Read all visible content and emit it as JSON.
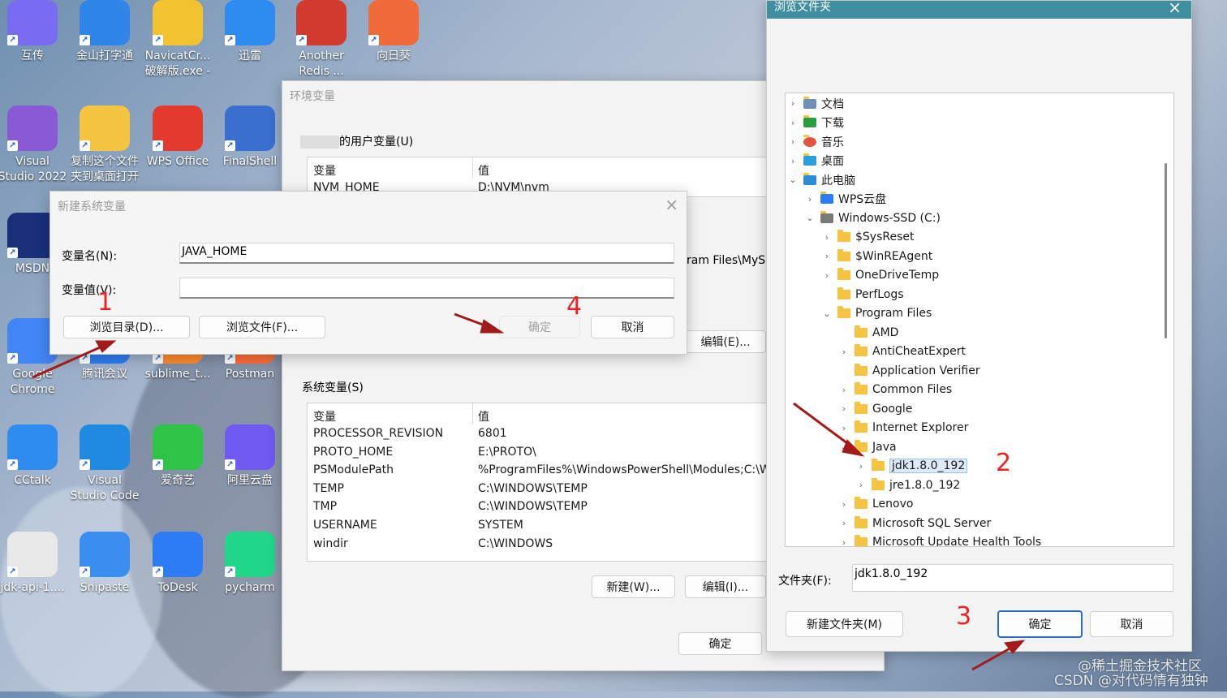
{
  "desktop_icons": [
    {
      "label": "互传",
      "color": "#7a6cf2"
    },
    {
      "label": "金山打字通",
      "color": "#2f86e8"
    },
    {
      "label": "NavicatCr... 破解版.exe -",
      "color": "#f2c230"
    },
    {
      "label": "迅雷",
      "color": "#2e8cf0"
    },
    {
      "label": "Another Redis ...",
      "color": "#d23a2f"
    },
    {
      "label": "向日葵",
      "color": "#f06a3a"
    },
    {
      "label": "Visual Studio 2022",
      "color": "#8a5ad6"
    },
    {
      "label": "复制这个文件夹到桌面打开",
      "color": "#f5c542"
    },
    {
      "label": "WPS Office",
      "color": "#e43a2e"
    },
    {
      "label": "FinalShell",
      "color": "#3a6fd0"
    },
    {
      "label": "MSDN",
      "color": "#1a2f7a"
    },
    {
      "label": "Google Chrome",
      "color": "#4285f4"
    },
    {
      "label": "腾讯会议",
      "color": "#2e7cf5"
    },
    {
      "label": "sublime_t...",
      "color": "#ff8a2e"
    },
    {
      "label": "Postman",
      "color": "#ff6c37"
    },
    {
      "label": "CCtalk",
      "color": "#2e8cf0"
    },
    {
      "label": "Visual Studio Code",
      "color": "#1f8ae0"
    },
    {
      "label": "爱奇艺",
      "color": "#2ec448"
    },
    {
      "label": "阿里云盘",
      "color": "#6f5af2"
    },
    {
      "label": "jdk-api-1....",
      "color": "#e8e8e8"
    },
    {
      "label": "Snipaste",
      "color": "#3a8ef0"
    },
    {
      "label": "ToDesk",
      "color": "#2e7cf5"
    },
    {
      "label": "pycharm",
      "color": "#21d789"
    }
  ],
  "env_window": {
    "title": "环境变量",
    "user_vars_label": "的用户变量(U)",
    "user_header": [
      "变量",
      "值"
    ],
    "user_rows": [
      [
        "NVM_HOME",
        "D:\\NVM\\nvm"
      ]
    ],
    "path_fragment": "ram Files\\MyS",
    "edit_user_btn": "编辑(E)...",
    "sys_vars_label": "系统变量(S)",
    "sys_header": [
      "变量",
      "值"
    ],
    "sys_rows": [
      [
        "PROCESSOR_REVISION",
        "6801"
      ],
      [
        "PROTO_HOME",
        "E:\\PROTO\\"
      ],
      [
        "PSModulePath",
        "%ProgramFiles%\\WindowsPowerShell\\Modules;C:\\W"
      ],
      [
        "TEMP",
        "C:\\WINDOWS\\TEMP"
      ],
      [
        "TMP",
        "C:\\WINDOWS\\TEMP"
      ],
      [
        "USERNAME",
        "SYSTEM"
      ],
      [
        "windir",
        "C:\\WINDOWS"
      ]
    ],
    "new_btn": "新建(W)...",
    "edit_btn": "编辑(I)...",
    "ok_btn": "确定"
  },
  "new_var_dialog": {
    "title": "新建系统变量",
    "name_label": "变量名(N):",
    "name_value": "JAVA_HOME",
    "value_label": "变量值(V):",
    "value_value": "",
    "browse_dir_btn": "浏览目录(D)...",
    "browse_file_btn": "浏览文件(F)...",
    "ok_btn": "确定",
    "cancel_btn": "取消"
  },
  "folder_dialog": {
    "title": "浏览文件夹",
    "tree": [
      {
        "label": "文档",
        "indent": 0,
        "chev": "›",
        "icon": "doc"
      },
      {
        "label": "下载",
        "indent": 0,
        "chev": "›",
        "icon": "download"
      },
      {
        "label": "音乐",
        "indent": 0,
        "chev": "›",
        "icon": "music"
      },
      {
        "label": "桌面",
        "indent": 0,
        "chev": "›",
        "icon": "desktop"
      },
      {
        "label": "此电脑",
        "indent": 0,
        "chev": "⌄",
        "icon": "pc"
      },
      {
        "label": "WPS云盘",
        "indent": 1,
        "chev": "›",
        "icon": "cloud"
      },
      {
        "label": "Windows-SSD (C:)",
        "indent": 1,
        "chev": "⌄",
        "icon": "drive"
      },
      {
        "label": "$SysReset",
        "indent": 2,
        "chev": "›",
        "icon": "folder"
      },
      {
        "label": "$WinREAgent",
        "indent": 2,
        "chev": "›",
        "icon": "folder"
      },
      {
        "label": "OneDriveTemp",
        "indent": 2,
        "chev": "›",
        "icon": "folder"
      },
      {
        "label": "PerfLogs",
        "indent": 2,
        "chev": "",
        "icon": "folder"
      },
      {
        "label": "Program Files",
        "indent": 2,
        "chev": "⌄",
        "icon": "folder"
      },
      {
        "label": "AMD",
        "indent": 3,
        "chev": "",
        "icon": "folder"
      },
      {
        "label": "AntiCheatExpert",
        "indent": 3,
        "chev": "›",
        "icon": "folder"
      },
      {
        "label": "Application Verifier",
        "indent": 3,
        "chev": "",
        "icon": "folder"
      },
      {
        "label": "Common Files",
        "indent": 3,
        "chev": "›",
        "icon": "folder"
      },
      {
        "label": "Google",
        "indent": 3,
        "chev": "›",
        "icon": "folder"
      },
      {
        "label": "Internet Explorer",
        "indent": 3,
        "chev": "›",
        "icon": "folder"
      },
      {
        "label": "Java",
        "indent": 3,
        "chev": "⌄",
        "icon": "folder"
      },
      {
        "label": "jdk1.8.0_192",
        "indent": 4,
        "chev": "›",
        "icon": "folder",
        "selected": true
      },
      {
        "label": "jre1.8.0_192",
        "indent": 4,
        "chev": "›",
        "icon": "folder"
      },
      {
        "label": "Lenovo",
        "indent": 3,
        "chev": "›",
        "icon": "folder"
      },
      {
        "label": "Microsoft SQL Server",
        "indent": 3,
        "chev": "›",
        "icon": "folder"
      },
      {
        "label": "Microsoft Update Health Tools",
        "indent": 3,
        "chev": "›",
        "icon": "folder"
      }
    ],
    "folder_label": "文件夹(F):",
    "folder_value": "jdk1.8.0_192",
    "new_folder_btn": "新建文件夹(M)",
    "ok_btn": "确定",
    "cancel_btn": "取消"
  },
  "annotations": {
    "n1": "1",
    "n2": "2",
    "n3": "3",
    "n4": "4"
  },
  "watermark": {
    "line1": "@稀土掘金技术社区",
    "line2": "CSDN @对代码情有独钟"
  }
}
